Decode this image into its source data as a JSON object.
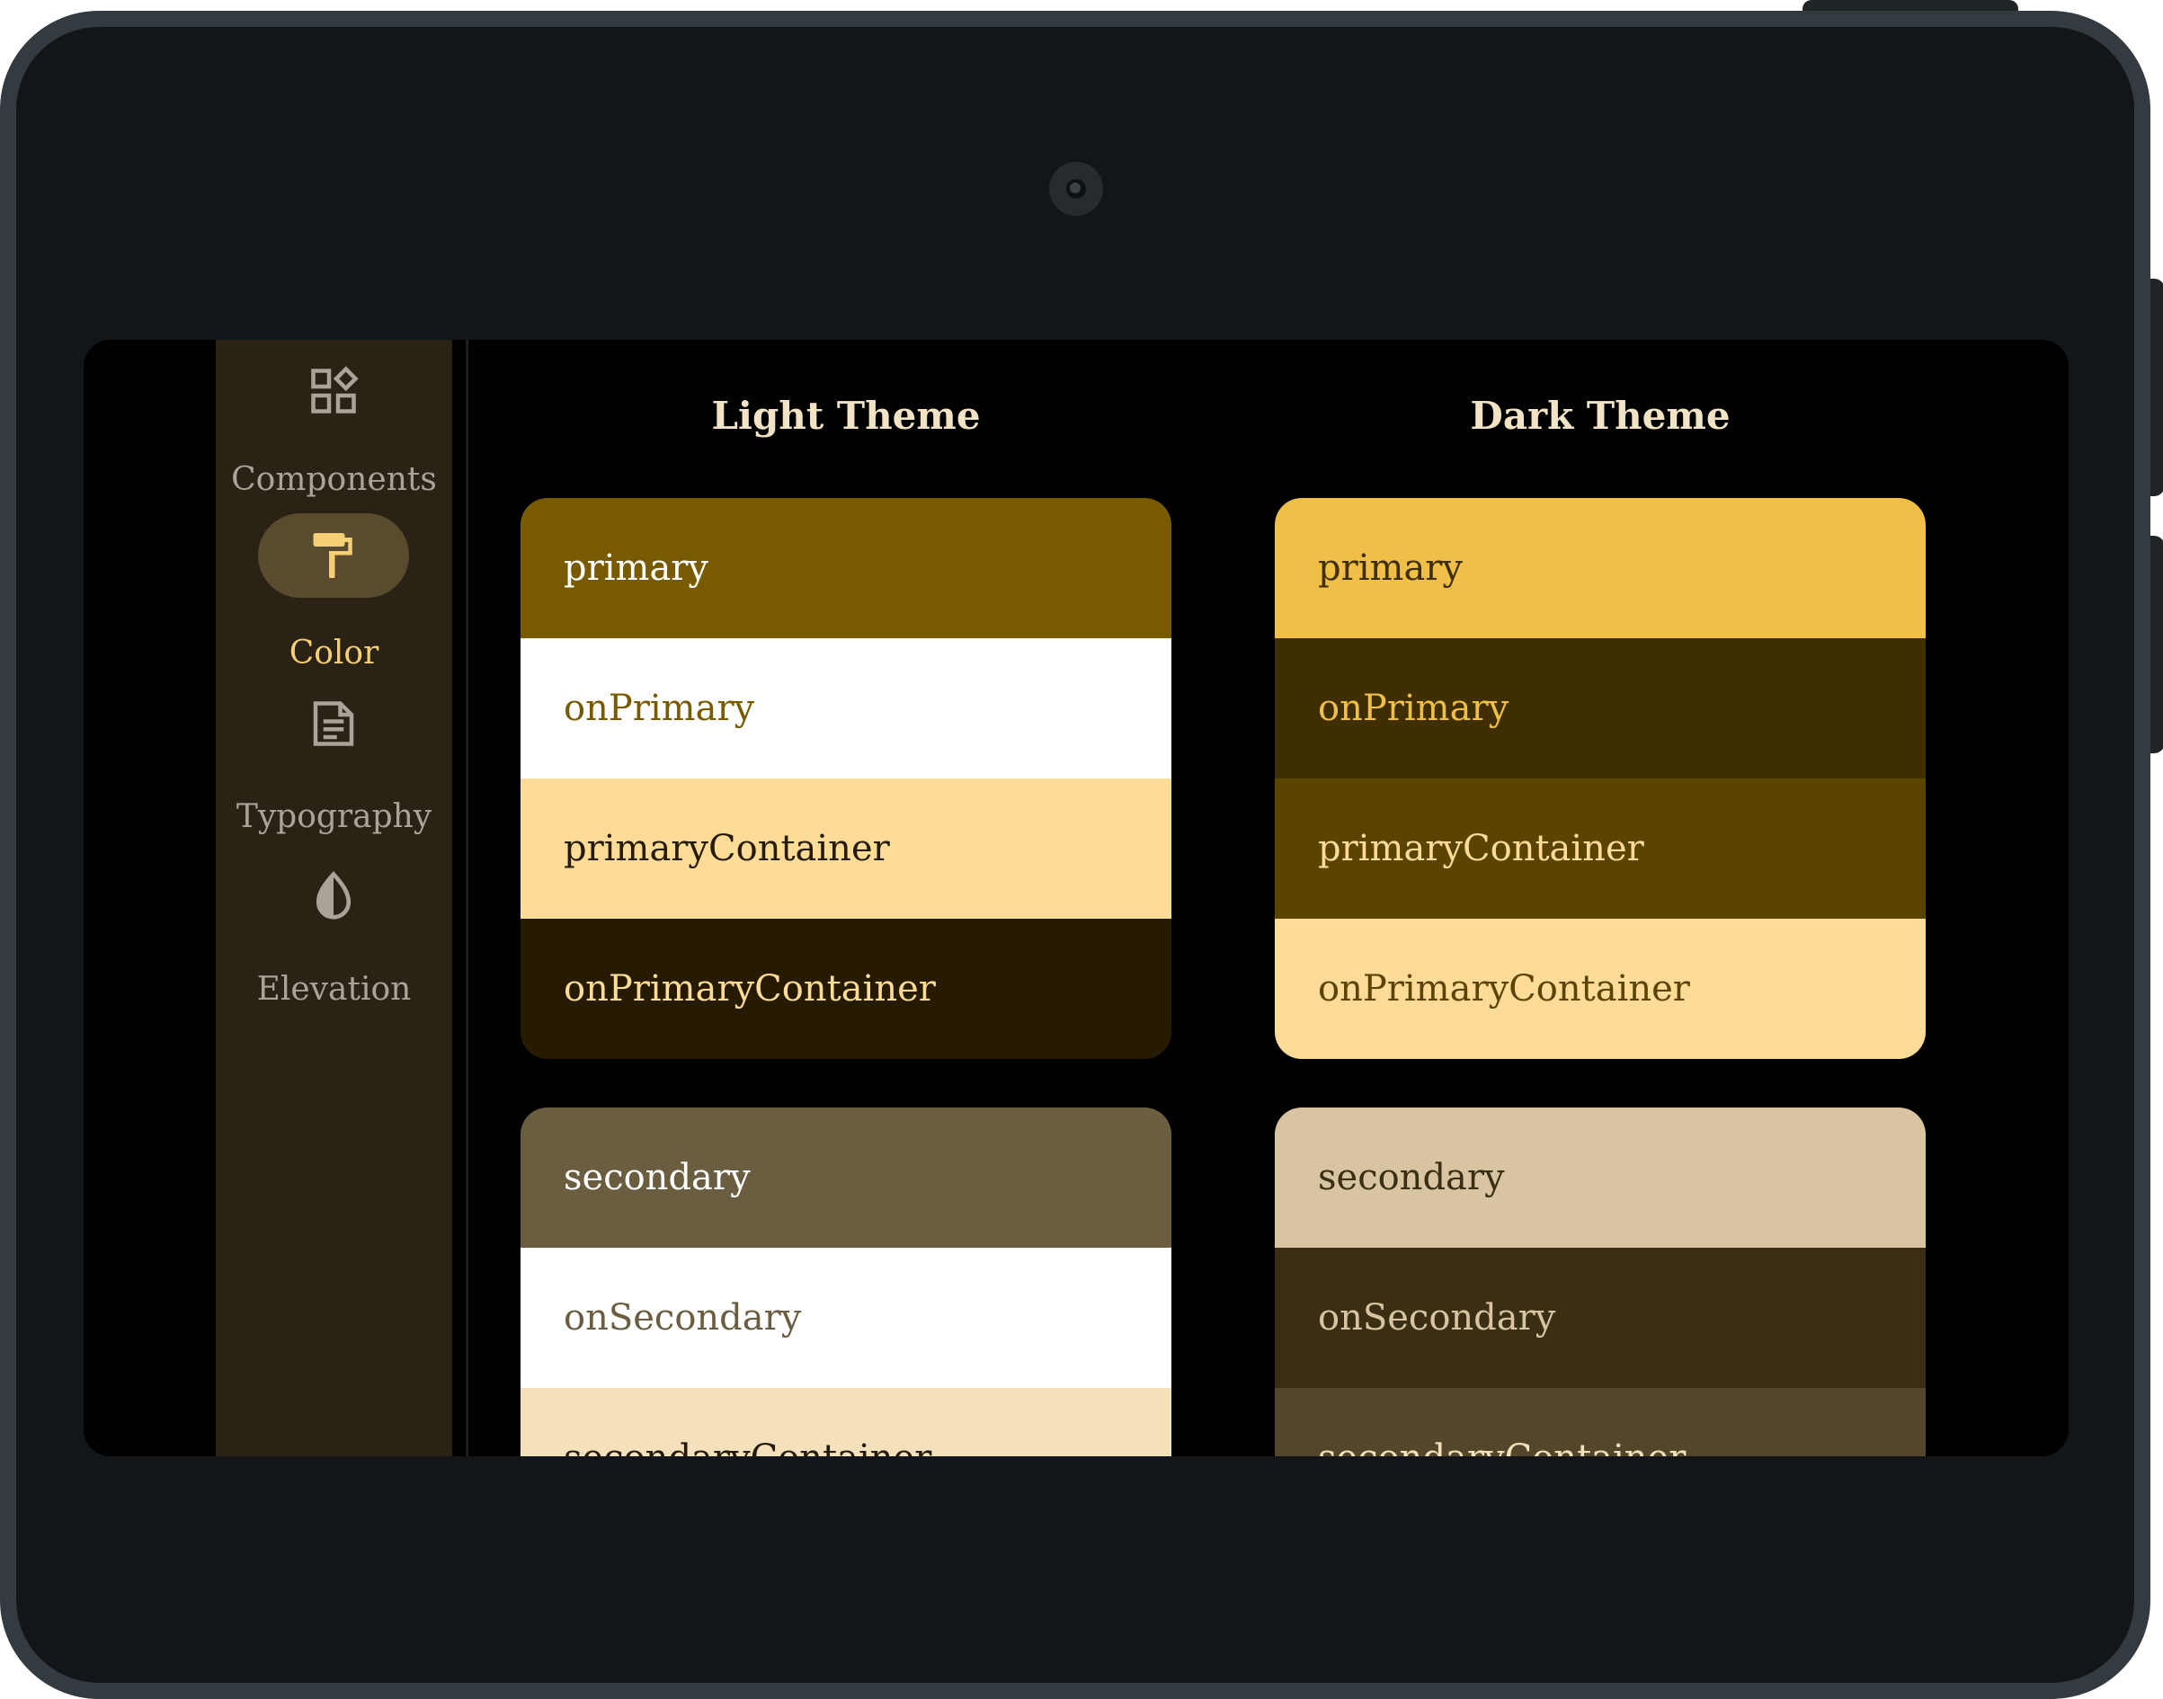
{
  "nav": {
    "items": [
      {
        "label": "Components",
        "icon": "components-icon"
      },
      {
        "label": "Color",
        "icon": "paint-roller-icon",
        "active": true
      },
      {
        "label": "Typography",
        "icon": "article-icon"
      },
      {
        "label": "Elevation",
        "icon": "opacity-drop-icon"
      }
    ]
  },
  "light": {
    "title": "Light Theme",
    "primary_group": [
      {
        "label": "primary",
        "bg": "#785a00",
        "fg": "#ffffff"
      },
      {
        "label": "onPrimary",
        "bg": "#ffffff",
        "fg": "#785a00"
      },
      {
        "label": "primaryContainer",
        "bg": "#fddc98",
        "fg": "#261a00"
      },
      {
        "label": "onPrimaryContainer",
        "bg": "#261a00",
        "fg": "#fddc98"
      }
    ],
    "secondary_group": [
      {
        "label": "secondary",
        "bg": "#6b5d3f",
        "fg": "#ffffff"
      },
      {
        "label": "onSecondary",
        "bg": "#ffffff",
        "fg": "#6b5d3f"
      },
      {
        "label": "secondaryContainer",
        "bg": "#f4e0bb",
        "fg": "#241a04"
      }
    ]
  },
  "dark": {
    "title": "Dark Theme",
    "primary_group": [
      {
        "label": "primary",
        "bg": "#f0bf48",
        "fg": "#3f2e00"
      },
      {
        "label": "onPrimary",
        "bg": "#3f2e00",
        "fg": "#f0bf48"
      },
      {
        "label": "primaryContainer",
        "bg": "#5b4300",
        "fg": "#fddc98"
      },
      {
        "label": "onPrimaryContainer",
        "bg": "#fddc98",
        "fg": "#5b4300"
      }
    ],
    "secondary_group": [
      {
        "label": "secondary",
        "bg": "#d8c4a0",
        "fg": "#3a2f15"
      },
      {
        "label": "onSecondary",
        "bg": "#3a2f15",
        "fg": "#d8c4a0"
      },
      {
        "label": "secondaryContainer",
        "bg": "#53462a",
        "fg": "#f4e0bb"
      }
    ]
  }
}
